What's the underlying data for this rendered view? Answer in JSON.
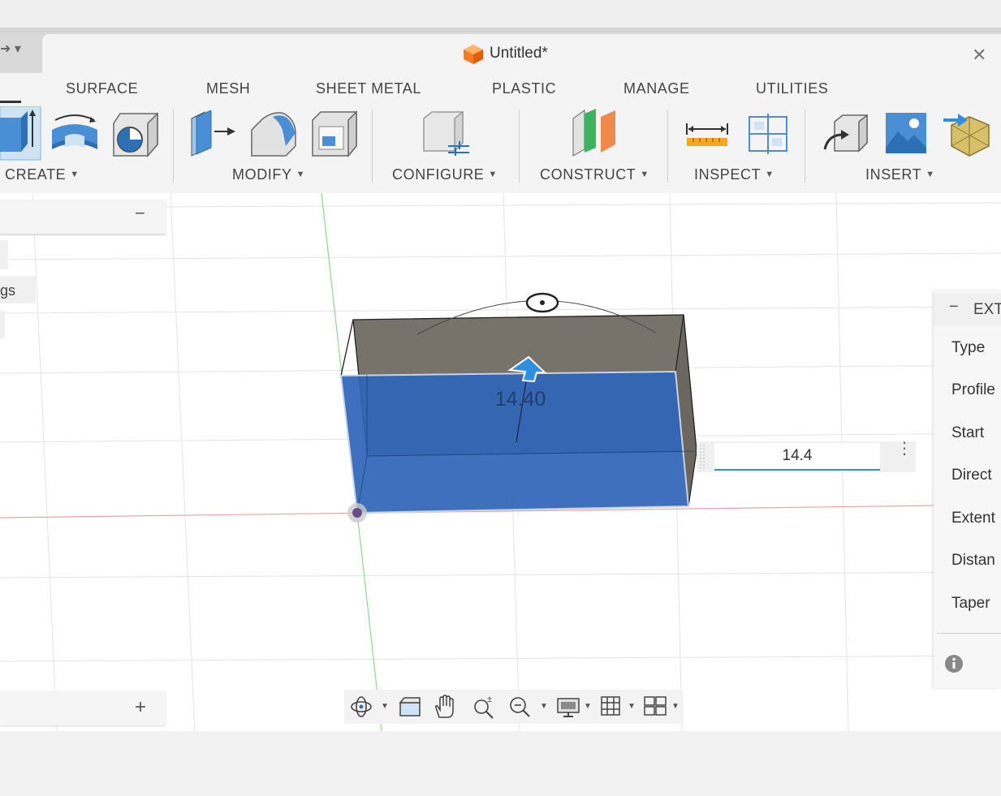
{
  "window": {
    "document_title": "Untitled*",
    "close_glyph": "✕",
    "left_tab_glyphs": "➜ ▾"
  },
  "ribbon": {
    "tabs": [
      "SURFACE",
      "MESH",
      "SHEET METAL",
      "PLASTIC",
      "MANAGE",
      "UTILITIES"
    ],
    "groups": [
      "CREATE",
      "MODIFY",
      "CONFIGURE",
      "CONSTRUCT",
      "INSPECT",
      "INSERT"
    ],
    "dropdown_caret": "▼"
  },
  "browser": {
    "collapse_glyph": "−",
    "partial_item": "gs"
  },
  "comments": {
    "add_glyph": "+"
  },
  "viewport": {
    "dimension_label": "14.40"
  },
  "dimension_input": {
    "value": "14.4",
    "menu_glyph": "⋮"
  },
  "extrude_panel": {
    "title": "EXT",
    "collapse_glyph": "−",
    "rows": [
      "Type",
      "Profile",
      "Start",
      "Direct",
      "Extent",
      "Distan",
      "Taper"
    ]
  },
  "colors": {
    "body_top": "#78736a",
    "face_selected": "#2f65b8",
    "accent": "#3f8ac9",
    "x_axis": "#e8a3a3",
    "y_axis": "#8fd88f"
  }
}
